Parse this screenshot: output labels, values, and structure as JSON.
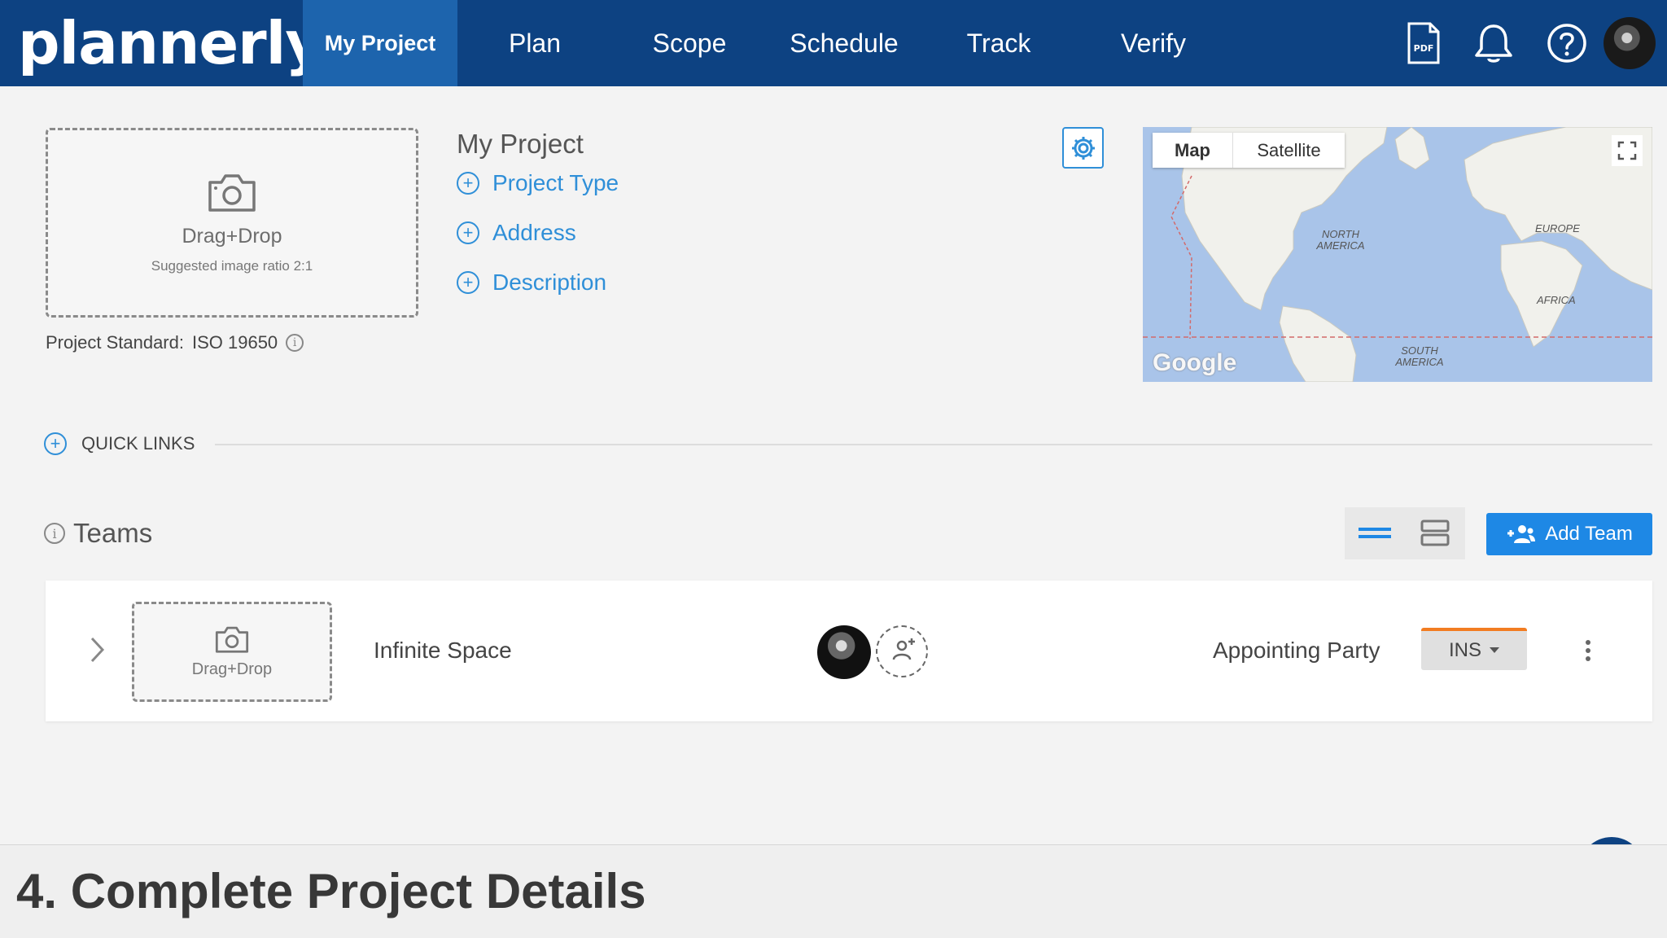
{
  "app": {
    "logo": "plannerly"
  },
  "nav": {
    "tabs": [
      {
        "label": "My Project"
      },
      {
        "label": "Plan"
      },
      {
        "label": "Scope"
      },
      {
        "label": "Schedule"
      },
      {
        "label": "Track"
      },
      {
        "label": "Verify"
      }
    ],
    "pdf_icon_text": "PDF"
  },
  "project": {
    "image_drop_label": "Drag+Drop",
    "image_drop_hint": "Suggested image ratio 2:1",
    "standard_label": "Project Standard:",
    "standard_value": "ISO 19650",
    "title": "My Project",
    "links": [
      "Project Type",
      "Address",
      "Description"
    ]
  },
  "map": {
    "map_label": "Map",
    "satellite_label": "Satellite",
    "regions": [
      "NORTH AMERICA",
      "EUROPE",
      "AFRICA",
      "SOUTH AMERICA"
    ],
    "provider": "Google"
  },
  "quick_links": {
    "label": "QUICK LINKS"
  },
  "teams": {
    "title": "Teams",
    "add_button": "Add Team",
    "rows": [
      {
        "image_drop_label": "Drag+Drop",
        "name": "Infinite Space",
        "role": "Appointing Party",
        "code": "INS"
      }
    ]
  },
  "caption": "4. Complete Project Details"
}
